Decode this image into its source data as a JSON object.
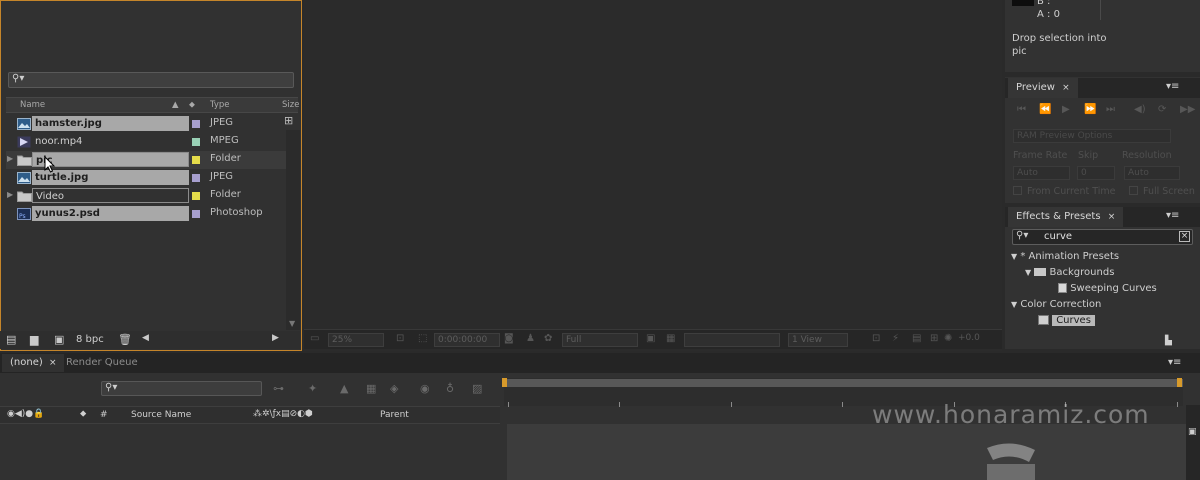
{
  "project": {
    "search_placeholder": "",
    "columns": {
      "name": "Name",
      "type": "Type",
      "size": "Size"
    },
    "items": [
      {
        "name": "hamster.jpg",
        "type": "JPEG",
        "icon": "image-file-icon",
        "label_color": "#a79fce",
        "selected": true
      },
      {
        "name": "noor.mp4",
        "type": "MPEG",
        "icon": "video-file-icon",
        "label_color": "#99d1b6",
        "selected": false
      },
      {
        "name": "pic",
        "type": "Folder",
        "icon": "folder-icon",
        "label_color": "#e5dc4a",
        "selected": true,
        "expandable": true
      },
      {
        "name": "turtle.jpg",
        "type": "JPEG",
        "icon": "image-file-icon",
        "label_color": "#a79fce",
        "selected": true
      },
      {
        "name": "Video",
        "type": "Folder",
        "icon": "folder-icon",
        "label_color": "#e5dc4a",
        "selected": false,
        "expandable": true
      },
      {
        "name": "yunus2.psd",
        "type": "Photoshop",
        "icon": "photoshop-file-icon",
        "label_color": "#a79fce",
        "selected": true
      }
    ],
    "footer": {
      "bpc": "8 bpc"
    }
  },
  "info": {
    "b_label": "B :",
    "a_label": "A : 0",
    "hint": "Drop selection into pic"
  },
  "preview": {
    "tab": "Preview",
    "ram_options": "RAM Preview Options",
    "frame_rate_label": "Frame Rate",
    "skip_label": "Skip",
    "resolution_label": "Resolution",
    "frame_rate_value": "Auto",
    "skip_value": "0",
    "resolution_value": "Auto",
    "from_current_time": "From Current Time",
    "full_screen": "Full Screen"
  },
  "effects": {
    "tab": "Effects & Presets",
    "search_value": "curve",
    "tree": [
      {
        "label": "* Animation Presets",
        "level": 0
      },
      {
        "label": "Backgrounds",
        "level": 1
      },
      {
        "label": "Sweeping Curves",
        "level": 2
      },
      {
        "label": "Color Correction",
        "level": 0
      },
      {
        "label": "Curves",
        "level": 1
      }
    ]
  },
  "viewer": {
    "zoom": "25%",
    "timecode": "0:00:00:00",
    "resolution": "Full",
    "view": "1 View",
    "exposure": "+0.0"
  },
  "timeline": {
    "tabs": [
      "(none)",
      "Render Queue"
    ],
    "columns": {
      "hash": "#",
      "source_name": "Source Name",
      "parent": "Parent"
    }
  },
  "watermark": "www.honaramiz.com",
  "colors": {
    "project_focus_border": "#c5852a",
    "selection": "#a8a8a8",
    "workarea_handle": "#d79a2b"
  }
}
